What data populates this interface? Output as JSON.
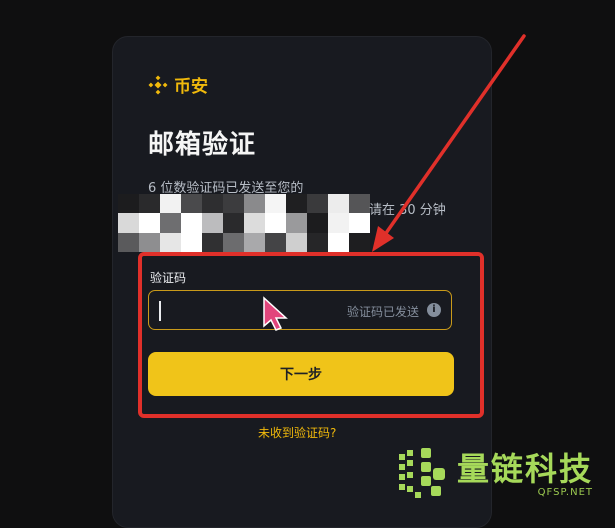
{
  "brand": {
    "name": "币安",
    "logo_icon": "binance-logo-icon",
    "color": "#f0b90b"
  },
  "title": "邮箱验证",
  "subtitle_line1": "6 位数验证码已发送至您的",
  "subtitle_line2": "请在 30 分钟",
  "redacted_email": "pixelated-mosaic",
  "field": {
    "label": "验证码",
    "value": "",
    "hint": "验证码已发送",
    "info_icon": "info-icon"
  },
  "next_button": "下一步",
  "resend_link": "未收到验证码?",
  "annotation": {
    "color": "#e0302a"
  },
  "watermark": {
    "name": "量链科技",
    "url": "QFSP.NET",
    "color": "#a6d95a"
  }
}
